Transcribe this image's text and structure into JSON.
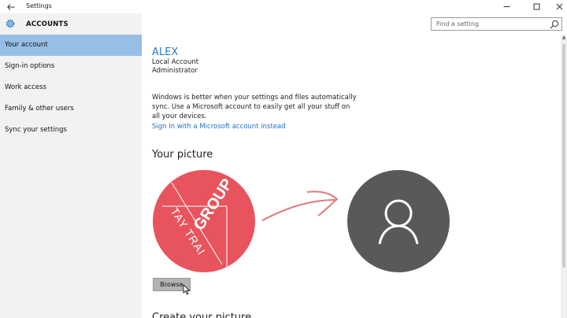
{
  "window": {
    "title": "Settings",
    "back_icon": "back-arrow-icon",
    "minimize_icon": "minimize-icon",
    "maximize_icon": "maximize-icon",
    "close_icon": "close-icon"
  },
  "sidebar": {
    "heading": "ACCOUNTS",
    "heading_icon": "gear-icon",
    "items": [
      {
        "label": "Your account",
        "active": true
      },
      {
        "label": "Sign-in options",
        "active": false
      },
      {
        "label": "Work access",
        "active": false
      },
      {
        "label": "Family & other users",
        "active": false
      },
      {
        "label": "Sync your settings",
        "active": false
      }
    ],
    "active_color": "#97bfe5"
  },
  "search": {
    "placeholder": "Find a setting",
    "icon": "search-icon"
  },
  "account": {
    "username": "ALEX",
    "account_type": "Local Account",
    "role": "Administrator",
    "sync_message": "Windows is better when your settings and files automatically sync. Use a Microsoft account to easily get all your stuff on all your devices.",
    "ms_link": "Sign in with a Microsoft account instead",
    "accent_color": "#2b79c2"
  },
  "picture": {
    "heading": "Your picture",
    "logo_text_1": "GROUP",
    "logo_text_2": "TAY TRAI",
    "logo_color": "#e8545d",
    "avatar_color": "#595959",
    "browse_label": "Browse"
  },
  "next_section": {
    "heading": "Create your picture"
  }
}
